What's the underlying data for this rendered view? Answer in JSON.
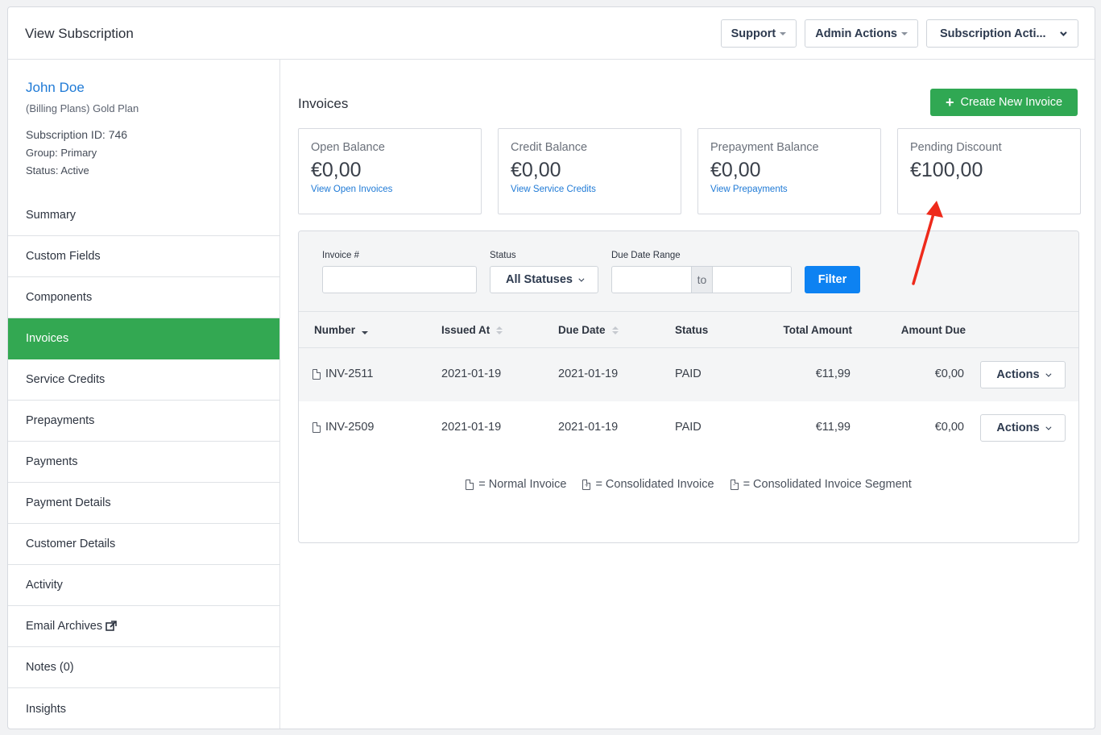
{
  "header": {
    "title": "View Subscription",
    "support_label": "Support",
    "admin_label": "Admin Actions",
    "subscription_label": "Subscription Acti..."
  },
  "customer": {
    "name": "John Doe",
    "plan": "(Billing Plans) Gold Plan",
    "subscription_id": "Subscription ID: 746",
    "group": "Group: Primary",
    "status": "Status: Active"
  },
  "nav": {
    "items": [
      {
        "label": "Summary"
      },
      {
        "label": "Custom Fields"
      },
      {
        "label": "Components"
      },
      {
        "label": "Invoices",
        "active": true
      },
      {
        "label": "Service Credits"
      },
      {
        "label": "Prepayments"
      },
      {
        "label": "Payments"
      },
      {
        "label": "Payment Details"
      },
      {
        "label": "Customer Details"
      },
      {
        "label": "Activity"
      },
      {
        "label": "Email Archives",
        "icon": "external-link-icon"
      },
      {
        "label": "Notes (0)"
      },
      {
        "label": "Insights"
      }
    ]
  },
  "invoices": {
    "title": "Invoices",
    "create_label": "Create New Invoice",
    "cards": [
      {
        "label": "Open Balance",
        "amount": "€0,00",
        "link": "View Open Invoices"
      },
      {
        "label": "Credit Balance",
        "amount": "€0,00",
        "link": "View Service Credits"
      },
      {
        "label": "Prepayment Balance",
        "amount": "€0,00",
        "link": "View Prepayments"
      },
      {
        "label": "Pending Discount",
        "amount": "€100,00"
      }
    ],
    "filters": {
      "invoice_label": "Invoice #",
      "status_label": "Status",
      "status_value": "All Statuses",
      "date_label": "Due Date Range",
      "to_label": "to",
      "filter_label": "Filter"
    },
    "columns": {
      "number": "Number",
      "issued": "Issued At",
      "due": "Due Date",
      "status": "Status",
      "total": "Total Amount",
      "amount_due": "Amount Due"
    },
    "rows": [
      {
        "number": "INV-2511",
        "issued": "2021-01-19",
        "due": "2021-01-19",
        "status": "PAID",
        "total": "€11,99",
        "amount_due": "€0,00",
        "action": "Actions"
      },
      {
        "number": "INV-2509",
        "issued": "2021-01-19",
        "due": "2021-01-19",
        "status": "PAID",
        "total": "€11,99",
        "amount_due": "€0,00",
        "action": "Actions"
      }
    ],
    "legend": {
      "normal": "= Normal Invoice",
      "consolidated": "= Consolidated Invoice",
      "segment": "= Consolidated Invoice Segment"
    }
  },
  "colors": {
    "accent_green": "#30a853",
    "link_blue": "#1f7ad6",
    "filter_blue": "#0d82f2",
    "annotation_red": "#ee2a1b"
  }
}
